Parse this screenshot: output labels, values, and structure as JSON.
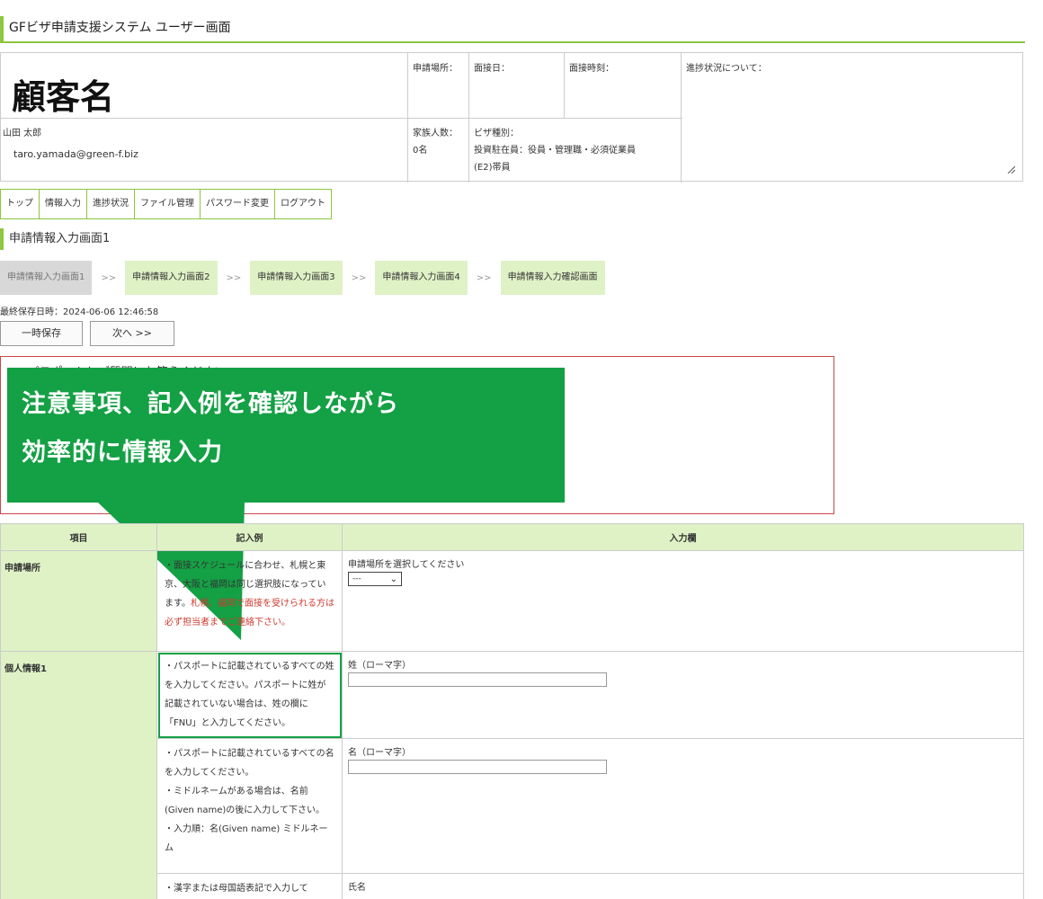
{
  "app": {
    "title": "GFビザ申請支援システム ユーザー画面"
  },
  "header": {
    "customer_label": "顧客名",
    "user_name": "山田 太郎",
    "user_email": "taro.yamada@green-f.biz",
    "apply_place": "申請場所：",
    "interview_date": "面接日：",
    "interview_time": "面接時刻：",
    "progress_note": "進捗状況について：",
    "family_label": "家族人数：",
    "family_value": "0名",
    "visa_type_label": "ビザ種別：",
    "visa_type_value_1": "投資駐在員：役員・管理職・必須従業員",
    "visa_type_value_2": "(E2)帯員"
  },
  "nav": {
    "items": [
      {
        "label": "トップ"
      },
      {
        "label": "情報入力"
      },
      {
        "label": "進捗状況"
      },
      {
        "label": "ファイル管理"
      },
      {
        "label": "パスワード変更"
      },
      {
        "label": "ログアウト"
      }
    ]
  },
  "page": {
    "section_title": "申請情報入力画面1"
  },
  "steps": {
    "separator": ">>",
    "items": [
      {
        "label": "申請情報入力画面1"
      },
      {
        "label": "申請情報入力画面2"
      },
      {
        "label": "申請情報入力画面3"
      },
      {
        "label": "申請情報入力画面4"
      },
      {
        "label": "申請情報入力確認画面"
      }
    ]
  },
  "toolbar": {
    "last_saved": "最終保存日時：2024-06-06 12:46:58",
    "save_label": "一時保存",
    "next_label": "次へ >>"
  },
  "notice": {
    "first_line": "★ パスポートとご質問にお答えください ★"
  },
  "callout": {
    "line1": "注意事項、記入例を確認しながら",
    "line2": "効率的に情報入力"
  },
  "table": {
    "headers": {
      "item": "項目",
      "example": "記入例",
      "input": "入力欄"
    },
    "row1": {
      "item": "申請場所",
      "example_normal": "・面接スケジュールに合わせ、札幌と東京、大阪と福岡は同じ選択肢になっています。",
      "example_red": "札幌、福岡で面接を受けられる方は必ず担当者までご連絡下さい。",
      "input_label": "申請場所を選択してください",
      "select_value": "---"
    },
    "row2": {
      "item": "個人情報1",
      "example": "・パスポートに記載されているすべての姓を入力してください。パスポートに姓が記載されていない場合は、姓の欄に「FNU」と入力してください。",
      "input_label": "姓（ローマ字）"
    },
    "row3": {
      "example": "・パスポートに記載されているすべての名を入力してください。\n・ミドルネームがある場合は、名前(Given name)の後に入力して下さい。\n・入力順：名(Given name) ミドルネーム",
      "input_label": "名（ローマ字）"
    },
    "row4": {
      "example": "・漢字または母国語表記で入力して",
      "input_label": "氏名"
    }
  }
}
